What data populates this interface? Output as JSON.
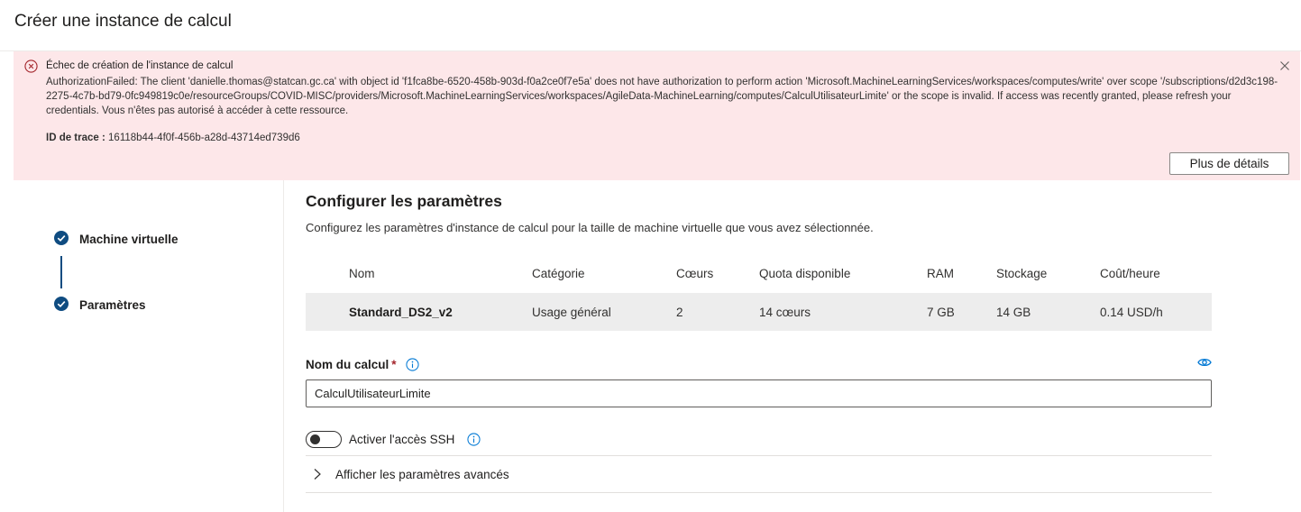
{
  "page": {
    "title": "Créer une instance de calcul"
  },
  "error": {
    "title": "Échec de création de l'instance de calcul",
    "message": "AuthorizationFailed: The client 'danielle.thomas@statcan.gc.ca' with object id 'f1fca8be-6520-458b-903d-f0a2ce0f7e5a' does not have authorization to perform action 'Microsoft.MachineLearningServices/workspaces/computes/write' over scope '/subscriptions/d2d3c198-2275-4c7b-bd79-0fc949819c0e/resourceGroups/COVID-MISC/providers/Microsoft.MachineLearningServices/workspaces/AgileData-MachineLearning/computes/CalculUtilisateurLimite' or the scope is invalid. If access was recently granted, please refresh your credentials. Vous n'êtes pas autorisé à accéder à cette ressource.",
    "trace_label": "ID de trace :",
    "trace_id": "16118b44-4f0f-456b-a28d-43714ed739d6",
    "details_button": "Plus de détails",
    "color": "#fde7e9",
    "icon_color": "#a4262c"
  },
  "steps": [
    {
      "label": "Machine virtuelle",
      "status": "completed"
    },
    {
      "label": "Paramètres",
      "status": "completed"
    }
  ],
  "settings": {
    "title": "Configurer les paramètres",
    "description": "Configurez les paramètres d'instance de calcul pour la taille de machine virtuelle que vous avez sélectionnée.",
    "table": {
      "headers": [
        "Nom",
        "Catégorie",
        "Cœurs",
        "Quota disponible",
        "RAM",
        "Stockage",
        "Coût/heure"
      ],
      "row": [
        "Standard_DS2_v2",
        "Usage général",
        "2",
        "14 cœurs",
        "7 GB",
        "14 GB",
        "0.14 USD/h"
      ]
    },
    "compute_name": {
      "label": "Nom du calcul",
      "required_mark": "*",
      "value": "CalculUtilisateurLimite"
    },
    "ssh": {
      "label": "Activer l'accès SSH",
      "enabled": false
    },
    "advanced": {
      "label": "Afficher les paramètres avancés"
    }
  },
  "colors": {
    "accent": "#0f4c81",
    "error_bg": "#fde7e9",
    "error_red": "#a4262c",
    "info_blue": "#0078d4"
  }
}
